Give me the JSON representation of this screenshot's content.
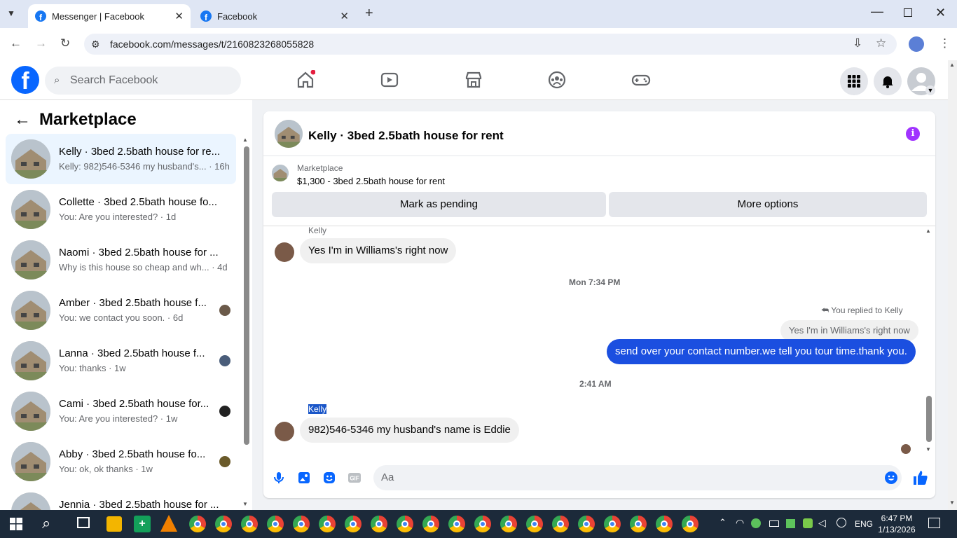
{
  "browser": {
    "tabs": [
      {
        "label": "Messenger | Facebook",
        "active": true
      },
      {
        "label": "Facebook",
        "active": false
      }
    ],
    "url": "facebook.com/messages/t/2160823268055828"
  },
  "fb_header": {
    "logo": "f",
    "search_placeholder": "Search Facebook"
  },
  "sidebar": {
    "title": "Marketplace",
    "conversations": [
      {
        "title": "Kelly · 3bed 2.5bath house for re...",
        "subtitle": "Kelly: 982)546-5346 my husband's... · 16h",
        "selected": true
      },
      {
        "title": "Collette · 3bed 2.5bath house fo...",
        "subtitle": "You: Are you interested? · 1d"
      },
      {
        "title": "Naomi · 3bed 2.5bath house for ...",
        "subtitle": "Why is this house so cheap and wh... · 4d"
      },
      {
        "title": "Amber · 3bed 2.5bath house f...",
        "subtitle": "You: we contact you soon. · 6d"
      },
      {
        "title": "Lanna · 3bed 2.5bath house f...",
        "subtitle": "You: thanks · 1w"
      },
      {
        "title": "Cami · 3bed 2.5bath house for...",
        "subtitle": "You: Are you interested? · 1w"
      },
      {
        "title": "Abby · 3bed 2.5bath house fo...",
        "subtitle": "You: ok, ok thanks · 1w"
      },
      {
        "title": "Jennia · 3bed 2.5bath house for ...",
        "subtitle": ""
      }
    ]
  },
  "chat": {
    "title": "Kelly · 3bed 2.5bath house for rent",
    "marketplace_label": "Marketplace",
    "listing": "$1,300 - 3bed 2.5bath house for rent",
    "mark_pending": "Mark as pending",
    "more_options": "More options",
    "messages": {
      "sender1": "Kelly",
      "msg1": "Yes I'm in Williams's right now",
      "time1": "Mon 7:34 PM",
      "reply_note": "You replied to Kelly",
      "quoted": "Yes I'm in Williams's right now",
      "msg2": "send over your contact number.we tell you tour time.thank you.",
      "time2": "2:41 AM",
      "sender2": "Kelly",
      "msg3": "982)546-5346 my husband's name is Eddie"
    },
    "composer_placeholder": "Aa"
  },
  "taskbar": {
    "lang": "ENG",
    "time": "6:47 PM",
    "date": "1/13/2026"
  }
}
